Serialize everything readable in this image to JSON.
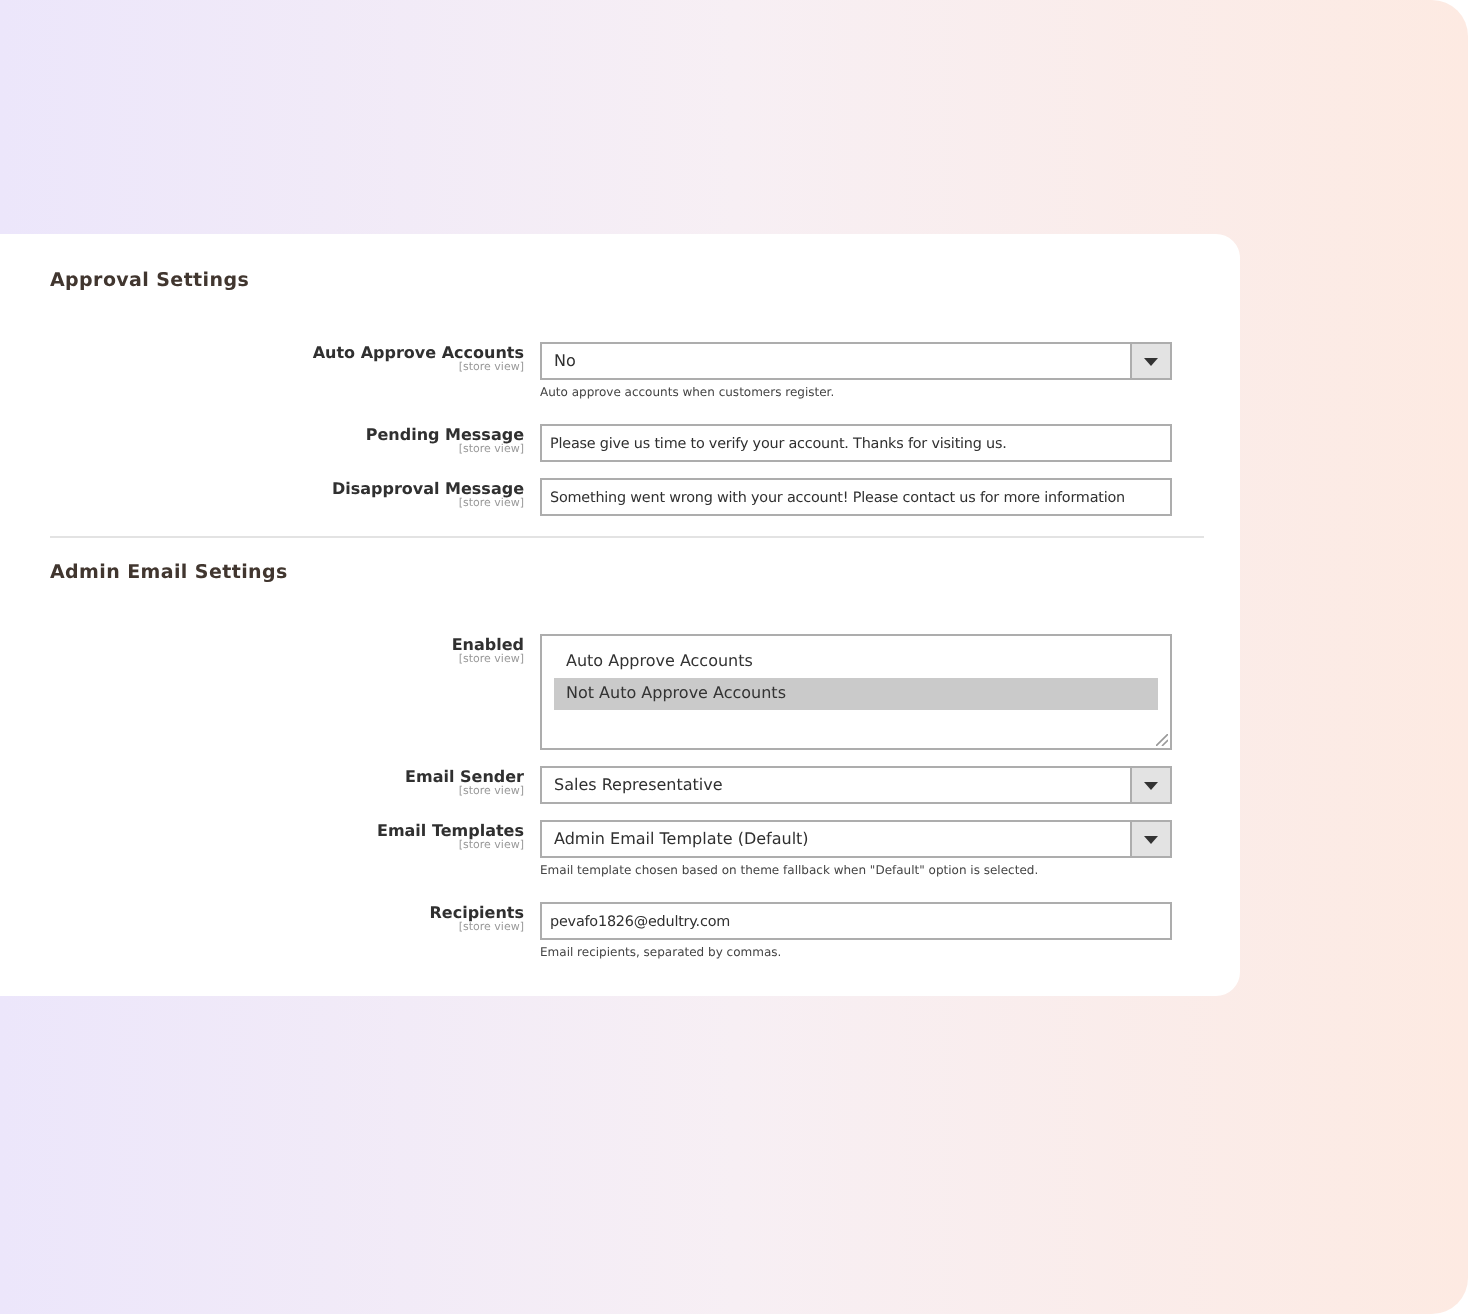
{
  "sections": [
    {
      "title": "Approval Settings",
      "fields": [
        {
          "kind": "select",
          "label": "Auto Approve Accounts",
          "scope": "[store view]",
          "value": "No",
          "hint": "Auto approve accounts when customers register."
        },
        {
          "kind": "text",
          "label": "Pending Message",
          "scope": "[store view]",
          "value": "Please give us time to verify your account. Thanks for visiting us."
        },
        {
          "kind": "text",
          "label": "Disapproval Message",
          "scope": "[store view]",
          "value": "Something went wrong with your account! Please contact us for more information"
        }
      ]
    },
    {
      "title": "Admin Email Settings",
      "fields": [
        {
          "kind": "multiselect",
          "label": "Enabled",
          "scope": "[store view]",
          "options": [
            {
              "label": "Auto Approve Accounts",
              "selected": false
            },
            {
              "label": "Not Auto Approve Accounts",
              "selected": true
            }
          ]
        },
        {
          "kind": "select",
          "label": "Email Sender",
          "scope": "[store view]",
          "value": "Sales Representative"
        },
        {
          "kind": "select",
          "label": "Email Templates",
          "scope": "[store view]",
          "value": "Admin Email Template (Default)",
          "hint": "Email template chosen based on theme fallback when \"Default\" option is selected."
        },
        {
          "kind": "text",
          "label": "Recipients",
          "scope": "[store view]",
          "value": "pevafo1826@edultry.com",
          "hint": "Email recipients, separated by commas."
        }
      ]
    }
  ]
}
